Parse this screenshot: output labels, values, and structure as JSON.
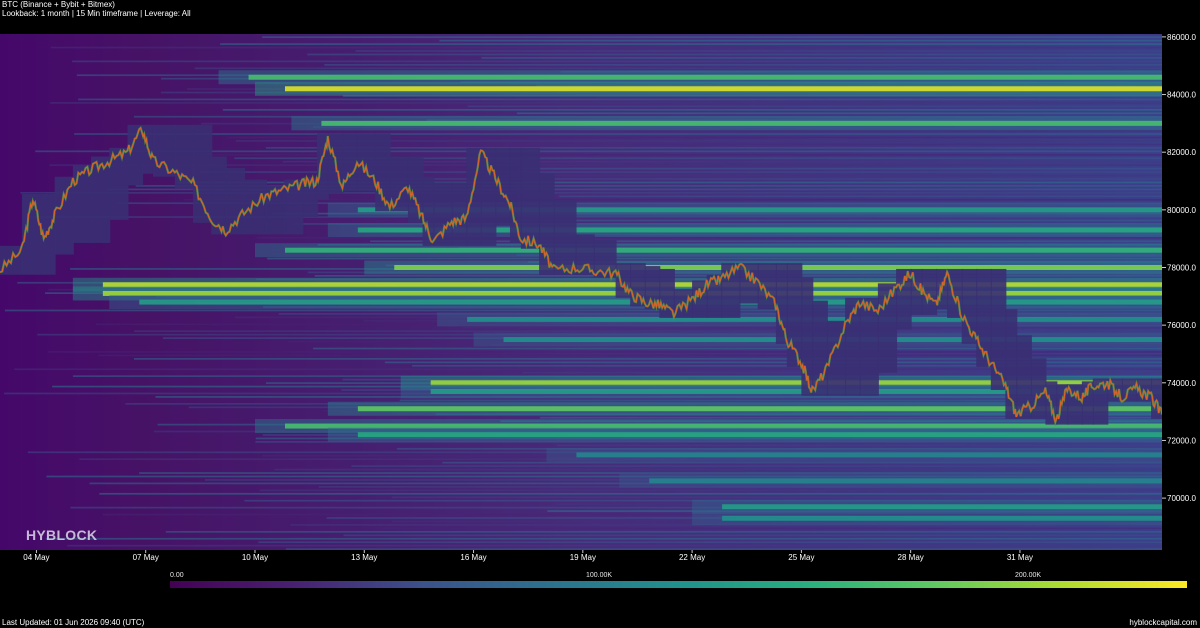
{
  "header": {
    "title": "BTC (Binance + Bybit + Bitmex)",
    "subtitle": "Lookback: 1 month | 15 Min timeframe | Leverage: All"
  },
  "brand": "HYBLOCK",
  "footer": {
    "last_updated": "Last Updated: 01 Jun 2026 09:40 (UTC)",
    "site": "hyblockcapital.com"
  },
  "colorbar": {
    "labels": [
      "0.00",
      "100.00K",
      "200.00K"
    ],
    "colors": [
      "#440154",
      "#482173",
      "#3b528b",
      "#2c728e",
      "#21918c",
      "#28ae80",
      "#5ec962",
      "#addc30",
      "#fde725"
    ]
  },
  "chart_data": {
    "type": "heatmap",
    "title": "BTC (Binance + Bybit + Bitmex)",
    "x_tick_labels": [
      "04 May",
      "07 May",
      "10 May",
      "13 May",
      "16 May",
      "19 May",
      "22 May",
      "25 May",
      "28 May",
      "31 May"
    ],
    "y_tick_labels": [
      "70000.0",
      "72000.0",
      "74000.0",
      "76000.0",
      "78000.0",
      "80000.0",
      "82000.0",
      "84000.0",
      "86000.0"
    ],
    "ylim": [
      68200,
      86100
    ],
    "xlim_day": [
      3,
      33
    ],
    "colorbar_range": [
      0,
      220000
    ],
    "liquidation_levels": [
      {
        "price": 84200,
        "intensity": 0.95,
        "start_day": 10
      },
      {
        "price": 84600,
        "intensity": 0.7,
        "start_day": 9
      },
      {
        "price": 83000,
        "intensity": 0.7,
        "start_day": 11
      },
      {
        "price": 80000,
        "intensity": 0.55,
        "start_day": 12
      },
      {
        "price": 79300,
        "intensity": 0.6,
        "start_day": 12
      },
      {
        "price": 78600,
        "intensity": 0.65,
        "start_day": 10
      },
      {
        "price": 78000,
        "intensity": 0.8,
        "start_day": 13
      },
      {
        "price": 77400,
        "intensity": 0.9,
        "start_day": 5
      },
      {
        "price": 77100,
        "intensity": 0.85,
        "start_day": 5
      },
      {
        "price": 76800,
        "intensity": 0.55,
        "start_day": 6
      },
      {
        "price": 76200,
        "intensity": 0.5,
        "start_day": 15
      },
      {
        "price": 75500,
        "intensity": 0.5,
        "start_day": 16
      },
      {
        "price": 74000,
        "intensity": 0.85,
        "start_day": 14
      },
      {
        "price": 73700,
        "intensity": 0.55,
        "start_day": 14
      },
      {
        "price": 73100,
        "intensity": 0.75,
        "start_day": 12
      },
      {
        "price": 72500,
        "intensity": 0.7,
        "start_day": 10
      },
      {
        "price": 72200,
        "intensity": 0.6,
        "start_day": 12
      },
      {
        "price": 71500,
        "intensity": 0.45,
        "start_day": 18
      },
      {
        "price": 70600,
        "intensity": 0.45,
        "start_day": 20
      },
      {
        "price": 69700,
        "intensity": 0.55,
        "start_day": 22
      },
      {
        "price": 69300,
        "intensity": 0.5,
        "start_day": 22
      }
    ],
    "price_series": {
      "name": "BTC",
      "points": [
        [
          3.0,
          77900
        ],
        [
          3.6,
          78600
        ],
        [
          3.9,
          80400
        ],
        [
          4.2,
          79000
        ],
        [
          4.5,
          79800
        ],
        [
          5.0,
          81000
        ],
        [
          5.5,
          81400
        ],
        [
          6.0,
          81700
        ],
        [
          6.5,
          82000
        ],
        [
          6.9,
          82800
        ],
        [
          7.2,
          81700
        ],
        [
          7.8,
          81300
        ],
        [
          8.3,
          80900
        ],
        [
          8.8,
          79700
        ],
        [
          9.2,
          79300
        ],
        [
          9.7,
          79900
        ],
        [
          10.3,
          80500
        ],
        [
          10.8,
          80700
        ],
        [
          11.3,
          80900
        ],
        [
          11.7,
          81000
        ],
        [
          12.0,
          82500
        ],
        [
          12.4,
          80800
        ],
        [
          12.8,
          81700
        ],
        [
          13.3,
          81000
        ],
        [
          13.7,
          80100
        ],
        [
          14.2,
          80800
        ],
        [
          14.6,
          79700
        ],
        [
          14.9,
          78900
        ],
        [
          15.4,
          79600
        ],
        [
          15.8,
          79700
        ],
        [
          16.2,
          82000
        ],
        [
          16.6,
          81100
        ],
        [
          17.0,
          80200
        ],
        [
          17.3,
          79000
        ],
        [
          17.8,
          78800
        ],
        [
          18.2,
          77900
        ],
        [
          18.8,
          78000
        ],
        [
          19.3,
          77900
        ],
        [
          19.9,
          77800
        ],
        [
          20.3,
          77100
        ],
        [
          20.7,
          76800
        ],
        [
          21.1,
          76700
        ],
        [
          21.5,
          76400
        ],
        [
          22.0,
          76900
        ],
        [
          22.4,
          77400
        ],
        [
          22.8,
          77600
        ],
        [
          23.3,
          78000
        ],
        [
          23.8,
          77500
        ],
        [
          24.3,
          76700
        ],
        [
          24.6,
          75500
        ],
        [
          25.0,
          74700
        ],
        [
          25.3,
          73700
        ],
        [
          25.7,
          74500
        ],
        [
          26.2,
          76000
        ],
        [
          26.6,
          76800
        ],
        [
          27.1,
          76500
        ],
        [
          27.6,
          77300
        ],
        [
          28.0,
          77800
        ],
        [
          28.3,
          77200
        ],
        [
          28.7,
          76700
        ],
        [
          29.0,
          77800
        ],
        [
          29.4,
          76400
        ],
        [
          29.8,
          75500
        ],
        [
          30.2,
          74700
        ],
        [
          30.6,
          73900
        ],
        [
          30.9,
          72900
        ],
        [
          31.3,
          73200
        ],
        [
          31.7,
          73700
        ],
        [
          32.0,
          72700
        ],
        [
          32.3,
          73800
        ],
        [
          32.7,
          73500
        ],
        [
          33.0,
          73900
        ],
        [
          33.4,
          74000
        ],
        [
          33.8,
          73500
        ],
        [
          34.2,
          73800
        ],
        [
          34.6,
          73500
        ],
        [
          34.9,
          72900
        ]
      ]
    }
  }
}
